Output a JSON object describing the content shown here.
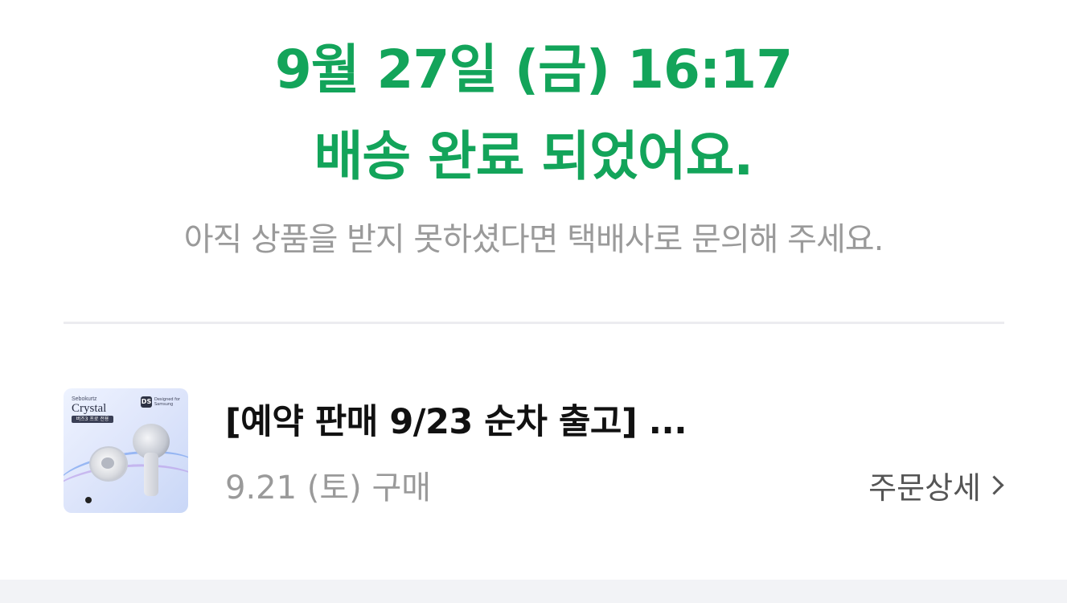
{
  "delivery": {
    "date_line": "9월 27일 (금) 16:17",
    "status_line": "배송 완료 되었어요.",
    "notice": "아직 상품을 받지 못하셨다면 택배사로 문의해 주세요."
  },
  "order": {
    "product_title": "[예약 판매 9/23 순차 출고] ...",
    "purchase_date": "9.21 (토) 구매",
    "detail_label": "주문상세",
    "thumbnail": {
      "brand_small": "Sebokurtz",
      "brand_title": "Crystal",
      "badge": "버즈3 프로 전용",
      "logo_mark": "DS",
      "logo_text": "Designed for Samsung"
    }
  },
  "colors": {
    "accent_green": "#13a45a",
    "muted_text": "#9a9a9a",
    "title_text": "#111111"
  },
  "icons": {
    "detail_chevron": "chevron-right-icon"
  }
}
